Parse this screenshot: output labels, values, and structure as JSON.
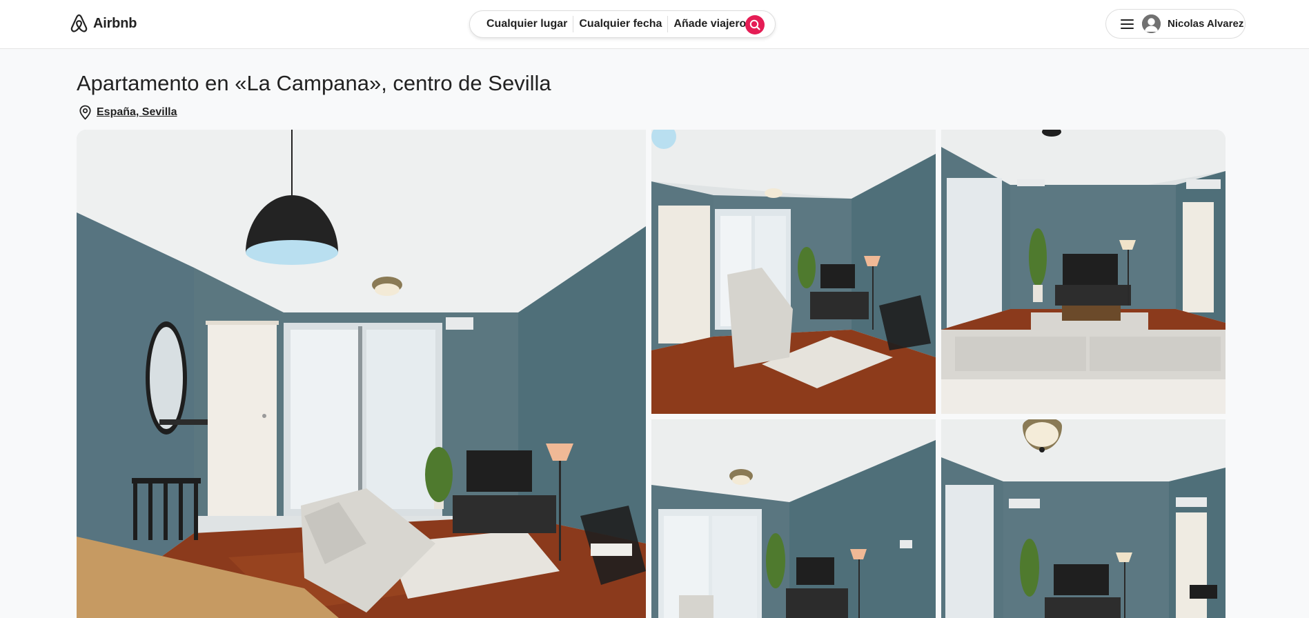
{
  "header": {
    "brand": "Airbnb",
    "search": {
      "place": "Cualquier lugar",
      "date": "Cualquier fecha",
      "guests": "Añade viajeros"
    },
    "user": {
      "name": "Nicolas Alvarez"
    }
  },
  "listing": {
    "title": "Apartamento en «La Campana», centro de Sevilla",
    "location": "España, Sevilla"
  },
  "icons": {
    "logo": "airbnb-logo-icon",
    "search": "search-icon",
    "menu": "hamburger-menu-icon",
    "avatar": "user-avatar-icon",
    "location": "map-pin-icon"
  },
  "colors": {
    "accent": "#e51d55",
    "wall": "#5a7680",
    "floor": "#8a3a1c"
  }
}
